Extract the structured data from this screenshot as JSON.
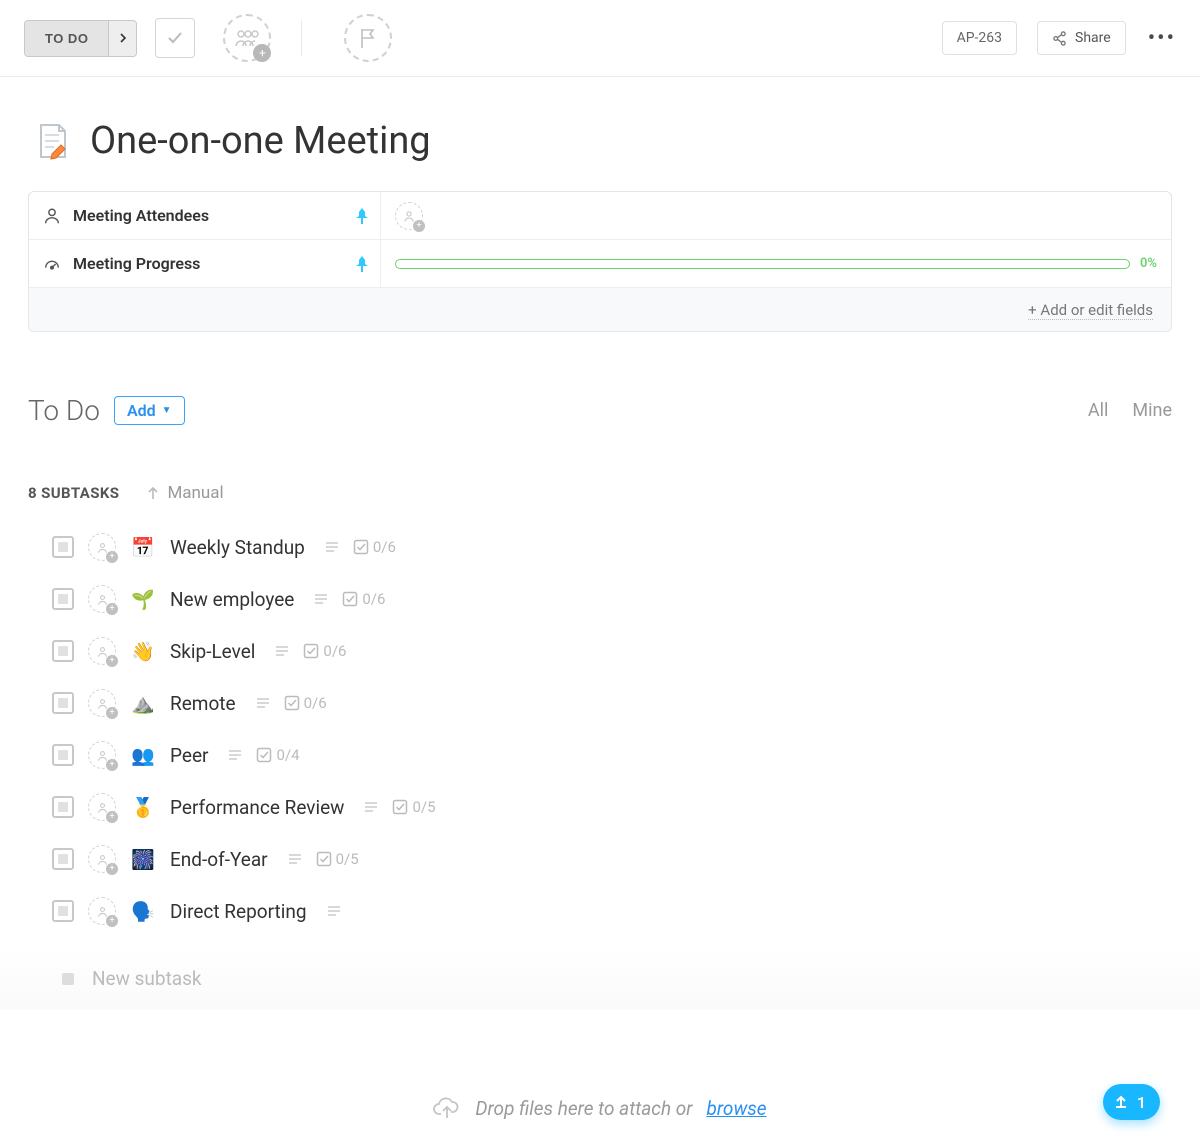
{
  "toolbar": {
    "status_label": "TO DO",
    "task_id": "AP-263",
    "share_label": "Share"
  },
  "title": "One-on-one Meeting",
  "fields": {
    "attendees_label": "Meeting Attendees",
    "progress_label": "Meeting Progress",
    "progress_pct": "0%",
    "add_edit_label": "+ Add or edit fields"
  },
  "section": {
    "title": "To Do",
    "add_label": "Add",
    "filter_all": "All",
    "filter_mine": "Mine"
  },
  "subtasks_header": {
    "count_label": "8 SUBTASKS",
    "sort_label": "Manual"
  },
  "subtasks": [
    {
      "emoji": "📅",
      "name": "Weekly Standup",
      "checklist": "0/6"
    },
    {
      "emoji": "🌱",
      "name": "New employee",
      "checklist": "0/6"
    },
    {
      "emoji": "👋",
      "name": "Skip-Level",
      "checklist": "0/6"
    },
    {
      "emoji": "⛰️",
      "name": "Remote",
      "checklist": "0/6"
    },
    {
      "emoji": "👥",
      "name": "Peer",
      "checklist": "0/4"
    },
    {
      "emoji": "🥇",
      "name": "Performance Review",
      "checklist": "0/5"
    },
    {
      "emoji": "🎆",
      "name": "End-of-Year",
      "checklist": "0/5"
    },
    {
      "emoji": "🗣️",
      "name": "Direct Reporting",
      "checklist": ""
    }
  ],
  "new_subtask_placeholder": "New subtask",
  "dropzone": {
    "text": "Drop files here to attach or ",
    "browse": "browse"
  },
  "upload_fab_count": "1"
}
